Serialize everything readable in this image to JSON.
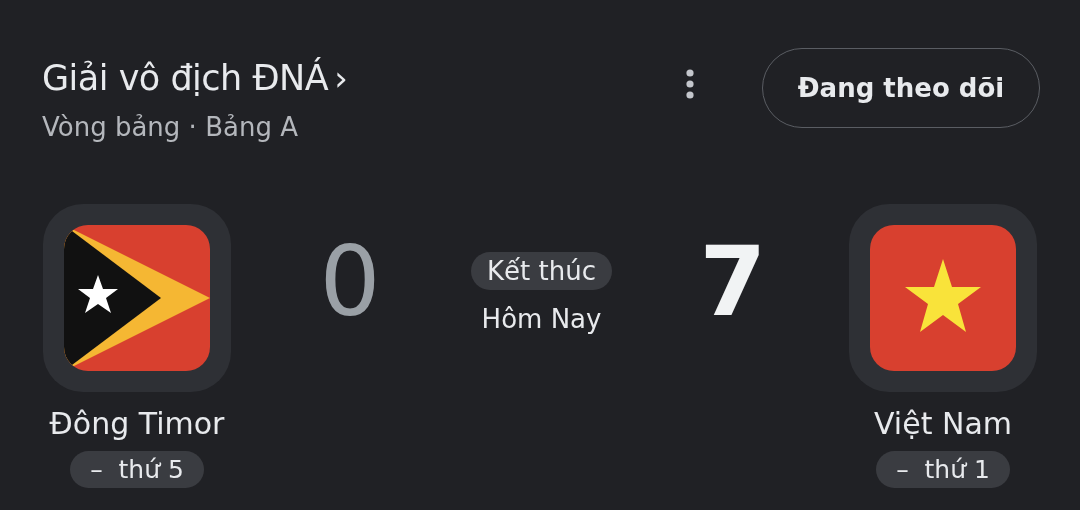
{
  "header": {
    "title": "Giải vô địch ĐNÁ",
    "title_chevron": "›",
    "subtitle": "Vòng bảng · Bảng A",
    "follow_button": "Đang theo dõi"
  },
  "match": {
    "status": "Kết thúc",
    "date": "Hôm Nay",
    "teams": [
      {
        "name": "Đông Timor",
        "score": "0",
        "winner": false,
        "kind": "timor",
        "rank": "–  thứ 5"
      },
      {
        "name": "Việt Nam",
        "score": "7",
        "winner": true,
        "kind": "vietnam",
        "rank": "–  thứ 1"
      }
    ]
  }
}
